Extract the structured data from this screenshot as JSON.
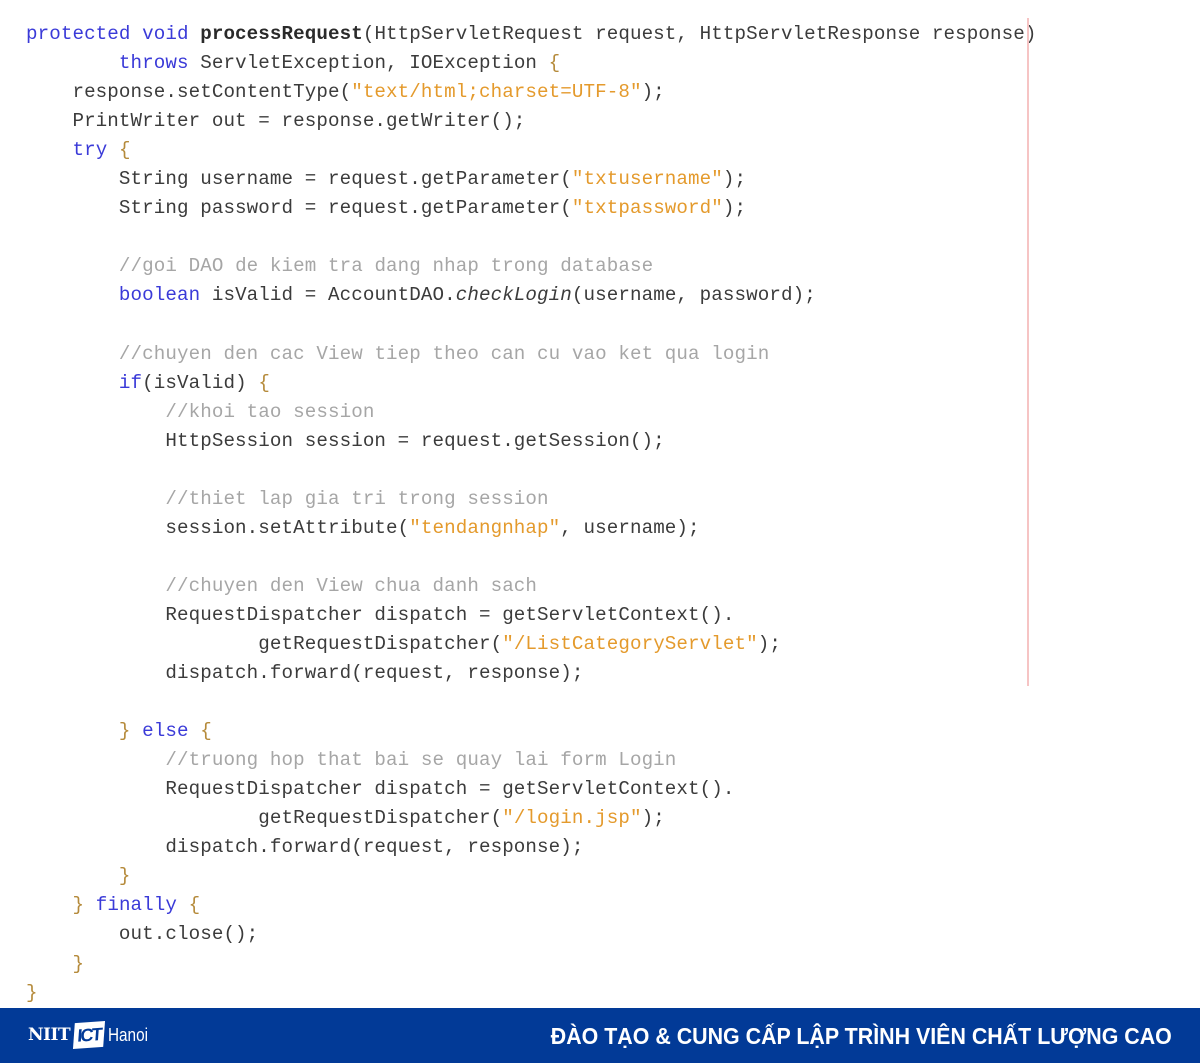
{
  "code": {
    "language": "java",
    "lines": [
      [
        {
          "t": "protected void ",
          "c": "kw"
        },
        {
          "t": "processRequest",
          "c": "bold"
        },
        {
          "t": "(HttpServletRequest request, HttpServletResponse response)",
          "c": "plain"
        }
      ],
      [
        {
          "t": "        ",
          "c": "plain"
        },
        {
          "t": "throws ",
          "c": "kw"
        },
        {
          "t": "ServletException, IOException ",
          "c": "plain"
        },
        {
          "t": "{",
          "c": "brace"
        }
      ],
      [
        {
          "t": "    response.setContentType(",
          "c": "plain"
        },
        {
          "t": "\"text/html;charset=UTF-8\"",
          "c": "str"
        },
        {
          "t": ");",
          "c": "plain"
        }
      ],
      [
        {
          "t": "    PrintWriter out = response.getWriter();",
          "c": "plain"
        }
      ],
      [
        {
          "t": "    ",
          "c": "plain"
        },
        {
          "t": "try ",
          "c": "kw"
        },
        {
          "t": "{",
          "c": "brace"
        }
      ],
      [
        {
          "t": "        String username = request.getParameter(",
          "c": "plain"
        },
        {
          "t": "\"txtusername\"",
          "c": "str"
        },
        {
          "t": ");",
          "c": "plain"
        }
      ],
      [
        {
          "t": "        String password = request.getParameter(",
          "c": "plain"
        },
        {
          "t": "\"txtpassword\"",
          "c": "str"
        },
        {
          "t": ");",
          "c": "plain"
        }
      ],
      [
        {
          "t": "",
          "c": "plain"
        }
      ],
      [
        {
          "t": "        ",
          "c": "plain"
        },
        {
          "t": "//goi DAO de kiem tra dang nhap trong database",
          "c": "cmt"
        }
      ],
      [
        {
          "t": "        ",
          "c": "plain"
        },
        {
          "t": "boolean ",
          "c": "kw"
        },
        {
          "t": "isValid = AccountDAO.",
          "c": "plain"
        },
        {
          "t": "checkLogin",
          "c": "ital"
        },
        {
          "t": "(username, password);",
          "c": "plain"
        }
      ],
      [
        {
          "t": "",
          "c": "plain"
        }
      ],
      [
        {
          "t": "        ",
          "c": "plain"
        },
        {
          "t": "//chuyen den cac View tiep theo can cu vao ket qua login",
          "c": "cmt"
        }
      ],
      [
        {
          "t": "        ",
          "c": "plain"
        },
        {
          "t": "if",
          "c": "kw"
        },
        {
          "t": "(isValid) ",
          "c": "plain"
        },
        {
          "t": "{",
          "c": "brace"
        }
      ],
      [
        {
          "t": "            ",
          "c": "plain"
        },
        {
          "t": "//khoi tao session",
          "c": "cmt"
        }
      ],
      [
        {
          "t": "            HttpSession session = request.getSession();",
          "c": "plain"
        }
      ],
      [
        {
          "t": "",
          "c": "plain"
        }
      ],
      [
        {
          "t": "            ",
          "c": "plain"
        },
        {
          "t": "//thiet lap gia tri trong session",
          "c": "cmt"
        }
      ],
      [
        {
          "t": "            session.setAttribute(",
          "c": "plain"
        },
        {
          "t": "\"tendangnhap\"",
          "c": "str"
        },
        {
          "t": ", username);",
          "c": "plain"
        }
      ],
      [
        {
          "t": "",
          "c": "plain"
        }
      ],
      [
        {
          "t": "            ",
          "c": "plain"
        },
        {
          "t": "//chuyen den View chua danh sach",
          "c": "cmt"
        }
      ],
      [
        {
          "t": "            RequestDispatcher dispatch = getServletContext().",
          "c": "plain"
        }
      ],
      [
        {
          "t": "                    getRequestDispatcher(",
          "c": "plain"
        },
        {
          "t": "\"/ListCategoryServlet\"",
          "c": "str"
        },
        {
          "t": ");",
          "c": "plain"
        }
      ],
      [
        {
          "t": "            dispatch.forward(request, response);",
          "c": "plain"
        }
      ],
      [
        {
          "t": "",
          "c": "plain"
        }
      ],
      [
        {
          "t": "        ",
          "c": "plain"
        },
        {
          "t": "}",
          "c": "brace"
        },
        {
          "t": " ",
          "c": "plain"
        },
        {
          "t": "else ",
          "c": "kw"
        },
        {
          "t": "{",
          "c": "brace"
        }
      ],
      [
        {
          "t": "            ",
          "c": "plain"
        },
        {
          "t": "//truong hop that bai se quay lai form Login",
          "c": "cmt"
        }
      ],
      [
        {
          "t": "            RequestDispatcher dispatch = getServletContext().",
          "c": "plain"
        }
      ],
      [
        {
          "t": "                    getRequestDispatcher(",
          "c": "plain"
        },
        {
          "t": "\"/login.jsp\"",
          "c": "str"
        },
        {
          "t": ");",
          "c": "plain"
        }
      ],
      [
        {
          "t": "            dispatch.forward(request, response);",
          "c": "plain"
        }
      ],
      [
        {
          "t": "        ",
          "c": "plain"
        },
        {
          "t": "}",
          "c": "brace"
        }
      ],
      [
        {
          "t": "    ",
          "c": "plain"
        },
        {
          "t": "}",
          "c": "brace"
        },
        {
          "t": " ",
          "c": "plain"
        },
        {
          "t": "finally ",
          "c": "kw"
        },
        {
          "t": "{",
          "c": "brace"
        }
      ],
      [
        {
          "t": "        out.close();",
          "c": "plain"
        }
      ],
      [
        {
          "t": "    ",
          "c": "plain"
        },
        {
          "t": "}",
          "c": "brace"
        }
      ],
      [
        {
          "t": "}",
          "c": "brace"
        }
      ]
    ]
  },
  "footer": {
    "logo": {
      "niit": "NIIT",
      "ict": "ICT",
      "city": "Hanoi"
    },
    "tagline": "ĐÀO TẠO & CUNG CẤP LẬP TRÌNH VIÊN CHẤT LƯỢNG CAO",
    "background_color": "#023a97"
  },
  "colors": {
    "keyword": "#3a3ad8",
    "string": "#e49a2c",
    "comment": "#a6a6a6",
    "text": "#3b3b3b",
    "margin_line": "#f6c4c4"
  }
}
